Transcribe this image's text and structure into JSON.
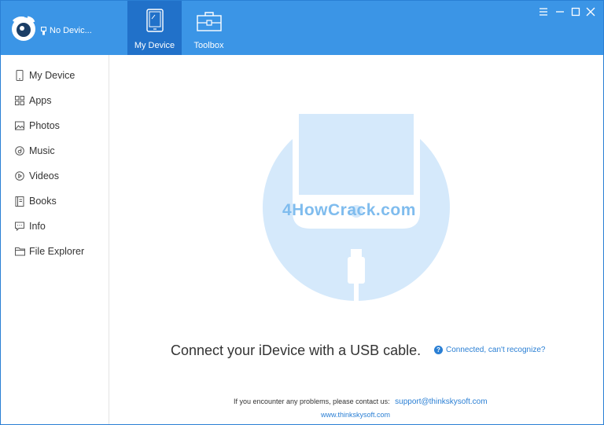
{
  "app": {
    "device_status": "No Devic...",
    "tabs": [
      {
        "label": "My Device",
        "icon": "tablet-icon",
        "active": true
      },
      {
        "label": "Toolbox",
        "icon": "toolbox-icon",
        "active": false
      }
    ],
    "window_controls": [
      "menu-icon",
      "minimize-icon",
      "maximize-icon",
      "close-icon"
    ]
  },
  "sidebar": {
    "items": [
      {
        "label": "My Device",
        "icon": "phone-icon"
      },
      {
        "label": "Apps",
        "icon": "apps-grid-icon"
      },
      {
        "label": "Photos",
        "icon": "image-icon"
      },
      {
        "label": "Music",
        "icon": "music-icon"
      },
      {
        "label": "Videos",
        "icon": "video-icon"
      },
      {
        "label": "Books",
        "icon": "book-icon"
      },
      {
        "label": "Info",
        "icon": "chat-icon"
      },
      {
        "label": "File Explorer",
        "icon": "folder-icon"
      }
    ]
  },
  "main": {
    "watermark": "4HowCrack.com",
    "connect_text": "Connect your iDevice with a USB cable.",
    "help_link": "Connected, can't recognize?",
    "contact_text": "If you encounter any problems, please contact us:",
    "contact_email": "support@thinkskysoft.com",
    "website": "www.thinkskysoft.com"
  },
  "colors": {
    "accent": "#3b95e6",
    "active_tab": "#2171c9",
    "link": "#2a7fd4",
    "illustration_circle": "#d5e9fb"
  }
}
